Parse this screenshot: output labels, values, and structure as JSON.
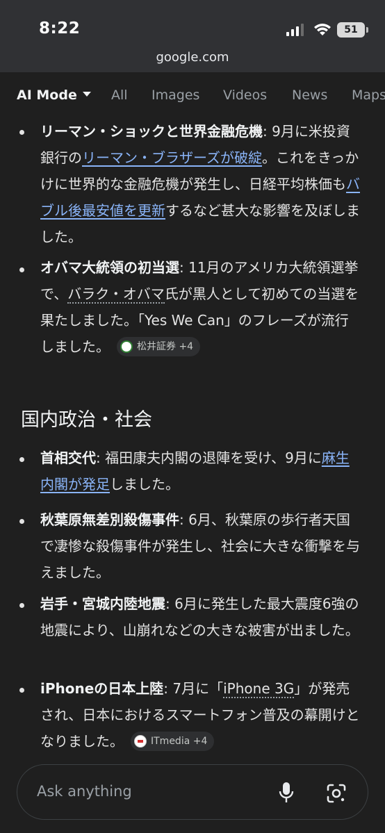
{
  "status_bar": {
    "time": "8:22",
    "battery": "51"
  },
  "url": "google.com",
  "tabs": [
    {
      "label": "AI Mode",
      "active": true
    },
    {
      "label": "All"
    },
    {
      "label": "Images"
    },
    {
      "label": "Videos"
    },
    {
      "label": "News"
    },
    {
      "label": "Maps"
    }
  ],
  "items1": [
    {
      "title": "リーマン・ショックと世界金融危機",
      "pre": ": 9月に米投資銀行の",
      "link1": "リーマン・ブラザーズが破綻",
      "mid": "。これをきっかけに世界的な金融危機が発生し、日経平均株価も",
      "link2": "バブル後最安値を更新",
      "post": "するなど甚大な影響を及ぼしました。"
    },
    {
      "title": "オバマ大統領の初当選",
      "pre": ": 11月のアメリカ大統領選挙で、",
      "dotted": "バラク・オバマ",
      "post": "氏が黒人として初めての当選を果たしました。「Yes We Can」のフレーズが流行しました。",
      "chip": "松井証券 +4"
    }
  ],
  "section_heading": "国内政治・社会",
  "items2": [
    {
      "title": "首相交代",
      "pre": ": 福田康夫内閣の退陣を受け、9月に",
      "link": "麻生内閣が発足",
      "post": "しました。"
    },
    {
      "title": "秋葉原無差別殺傷事件",
      "text": ": 6月、秋葉原の歩行者天国で凄惨な殺傷事件が発生し、社会に大きな衝撃を与えました。"
    },
    {
      "title": "岩手・宮城内陸地震",
      "text": ": 6月に発生した最大震度6強の地震により、山崩れなどの大きな被害が出ました。"
    },
    {
      "title": "iPhoneの日本上陸",
      "pre": ": 7月に「",
      "dotted": "iPhone 3G",
      "post": "」が発売され、日本におけるスマートフォン普及の幕開けとなりました。",
      "chip": "ITmedia +4"
    }
  ],
  "ask_bar": {
    "placeholder": "Ask anything"
  }
}
